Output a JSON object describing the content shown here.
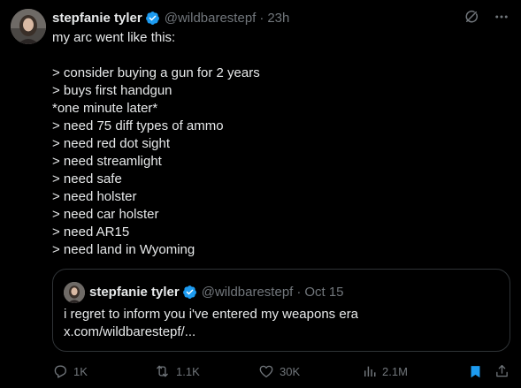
{
  "tweet": {
    "author_name": "stepfanie tyler",
    "handle": "@wildbarestepf",
    "separator": "·",
    "time": "23h",
    "lines": [
      "my arc went like this:",
      "",
      "> consider buying a gun for 2 years",
      "> buys first handgun",
      "*one minute later*",
      "> need 75 diff types of ammo",
      "> need red dot sight",
      "> need streamlight",
      "> need safe",
      "> need holster",
      "> need car holster",
      "> need AR15",
      "> need land in Wyoming"
    ]
  },
  "quoted": {
    "author_name": "stepfanie tyler",
    "handle": "@wildbarestepf",
    "separator": "·",
    "date": "Oct 15",
    "text": "i regret to inform you i've entered my weapons era",
    "link": "x.com/wildbarestepf/..."
  },
  "actions": {
    "replies": "1K",
    "reposts": "1.1K",
    "likes": "30K",
    "views": "2.1M"
  },
  "icons": {
    "verified": "verified-badge-icon",
    "grok": "grok-icon",
    "more": "more-icon",
    "reply": "reply-icon",
    "repost": "repost-icon",
    "like": "like-icon",
    "views": "views-icon",
    "bookmark": "bookmark-icon",
    "share": "share-icon"
  },
  "colors": {
    "background": "#000000",
    "text": "#e7e9ea",
    "muted": "#71767b",
    "verified": "#1d9bf0",
    "bookmark_active": "#1d9bf0",
    "border": "#2f3336"
  }
}
